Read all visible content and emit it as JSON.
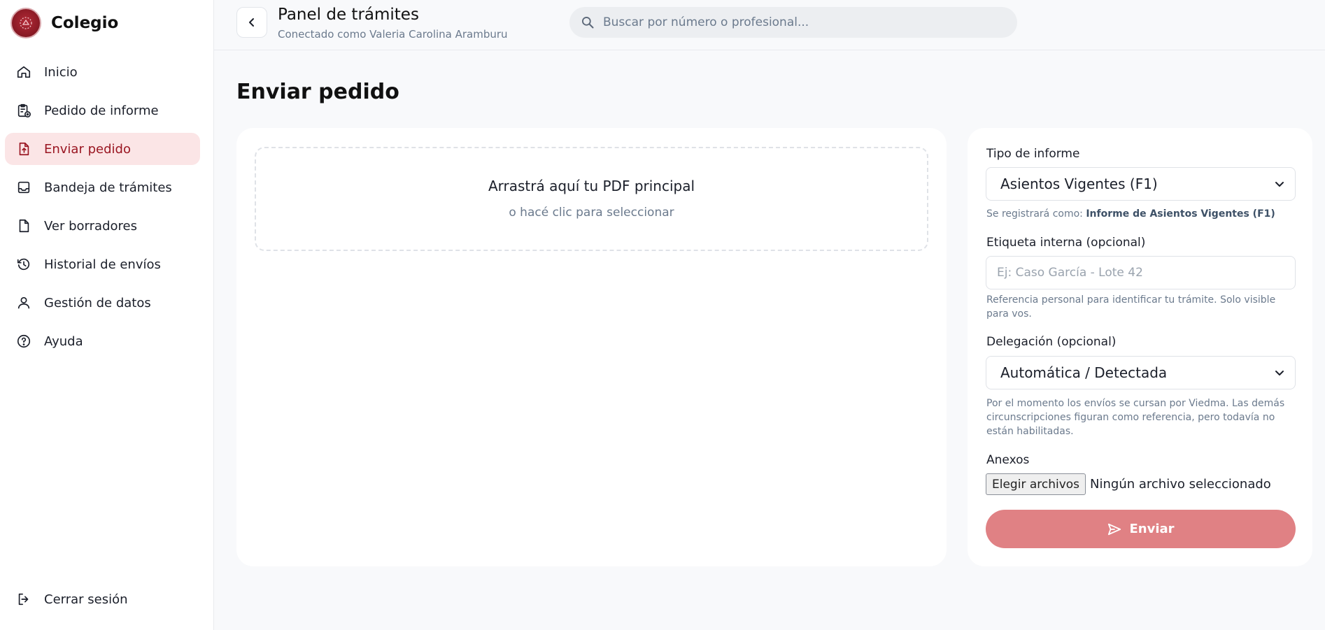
{
  "brand": {
    "name": "Colegio"
  },
  "sidebar": {
    "items": [
      {
        "label": "Inicio",
        "icon": "home-icon"
      },
      {
        "label": "Pedido de informe",
        "icon": "clipboard-plus-icon"
      },
      {
        "label": "Enviar pedido",
        "icon": "file-upload-icon",
        "active": true
      },
      {
        "label": "Bandeja de trámites",
        "icon": "inbox-icon"
      },
      {
        "label": "Ver borradores",
        "icon": "file-icon"
      },
      {
        "label": "Historial de envíos",
        "icon": "history-icon"
      },
      {
        "label": "Gestión de datos",
        "icon": "user-icon"
      },
      {
        "label": "Ayuda",
        "icon": "help-icon"
      }
    ],
    "logout_label": "Cerrar sesión"
  },
  "header": {
    "title": "Panel de trámites",
    "subtitle": "Conectado como Valeria Carolina Aramburu",
    "search_placeholder": "Buscar por número o profesional..."
  },
  "main": {
    "title": "Enviar pedido",
    "dropzone": {
      "title": "Arrastrá aquí tu PDF principal",
      "subtitle": "o hacé clic para seleccionar"
    },
    "form": {
      "tipo_label": "Tipo de informe",
      "tipo_value": "Asientos Vigentes (F1)",
      "registro_prefix": "Se registrará como: ",
      "registro_value": "Informe de Asientos Vigentes (F1)",
      "etiqueta_label": "Etiqueta interna (opcional)",
      "etiqueta_placeholder": "Ej: Caso García - Lote 42",
      "etiqueta_help": "Referencia personal para identificar tu trámite. Solo visible para vos.",
      "delegacion_label": "Delegación (opcional)",
      "delegacion_value": "Automática / Detectada",
      "delegacion_help": "Por el momento los envíos se cursan por Viedma. Las demás circunscripciones figuran como referencia, pero todavía no están habilitadas.",
      "anexos_label": "Anexos",
      "file_button": "Elegir archivos",
      "file_status": "Ningún archivo seleccionado",
      "submit_label": "Enviar"
    }
  },
  "colors": {
    "accent": "#9a1622",
    "active_bg": "#fbe5e6",
    "submit_bg": "#e08184"
  }
}
